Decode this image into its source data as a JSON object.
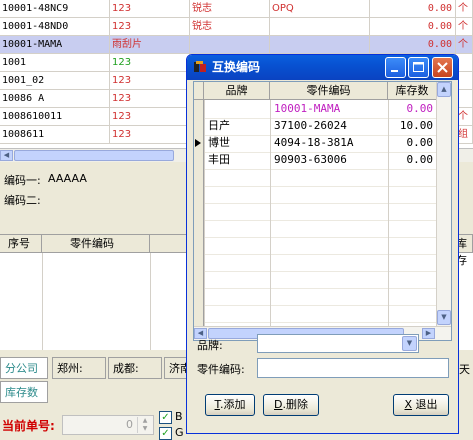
{
  "bg_grid": {
    "rows": [
      {
        "code": "10001-48NC9",
        "brand": "123",
        "name": "锐志",
        "spec": "OPQ",
        "qty": "0.00",
        "unit": "个"
      },
      {
        "code": "10001-48ND0",
        "brand": "123",
        "name": "锐志",
        "spec": "",
        "qty": "0.00",
        "unit": "个"
      },
      {
        "code": "10001-MAMA",
        "brand": "雨刮片",
        "name": "",
        "spec": "",
        "qty": "0.00",
        "unit": "个"
      },
      {
        "code": "1001",
        "brand": "123",
        "name": "",
        "spec": "",
        "qty": "",
        "unit": ""
      },
      {
        "code": "1001_02",
        "brand": "123",
        "name": "",
        "spec": "",
        "qty": "",
        "unit": ""
      },
      {
        "code": "10086 A",
        "brand": "123",
        "name": "",
        "spec": "",
        "qty": "",
        "unit": ""
      },
      {
        "code": "1008610011",
        "brand": "123",
        "name": "",
        "spec": "",
        "qty": "0.00",
        "unit": "个"
      },
      {
        "code": "1008611",
        "brand": "123",
        "name": "",
        "spec": "",
        "qty": "",
        "unit": "组"
      }
    ]
  },
  "mid_panel": {
    "code1_label": "编码一:",
    "code1_value": "AAAAA",
    "code2_label": "编码二:"
  },
  "lower_table": {
    "headers": [
      "序号",
      "零件编码"
    ],
    "right_header": "库存"
  },
  "branch_bar": {
    "branch_label": "分公司",
    "cities": [
      "郑州:",
      "成都:",
      "济南"
    ],
    "stock_label": "库存数",
    "right_char": "天"
  },
  "bottom_bar": {
    "order_label": "当前单号:",
    "order_value": "0",
    "check1_label": "B",
    "check2_label": "G"
  },
  "dialog": {
    "title": "互换编码",
    "headers": [
      "品牌",
      "零件编码",
      "库存数"
    ],
    "rows": [
      {
        "brand": "",
        "code": "10001-MAMA",
        "qty": "0.00",
        "highlight": true
      },
      {
        "brand": "日产",
        "code": "37100-26024",
        "qty": "10.00"
      },
      {
        "brand": "博世",
        "code": "4094-18-381A",
        "qty": "0.00",
        "current": true
      },
      {
        "brand": "丰田",
        "code": "90903-63006",
        "qty": "0.00"
      }
    ],
    "brand_label": "品牌:",
    "part_code_label": "零件编码:",
    "add_button": {
      "key": "T",
      "label": ".添加"
    },
    "delete_button": {
      "key": "D",
      "label": ".删除"
    },
    "exit_button": {
      "key": "X",
      "label": " 退出"
    }
  }
}
